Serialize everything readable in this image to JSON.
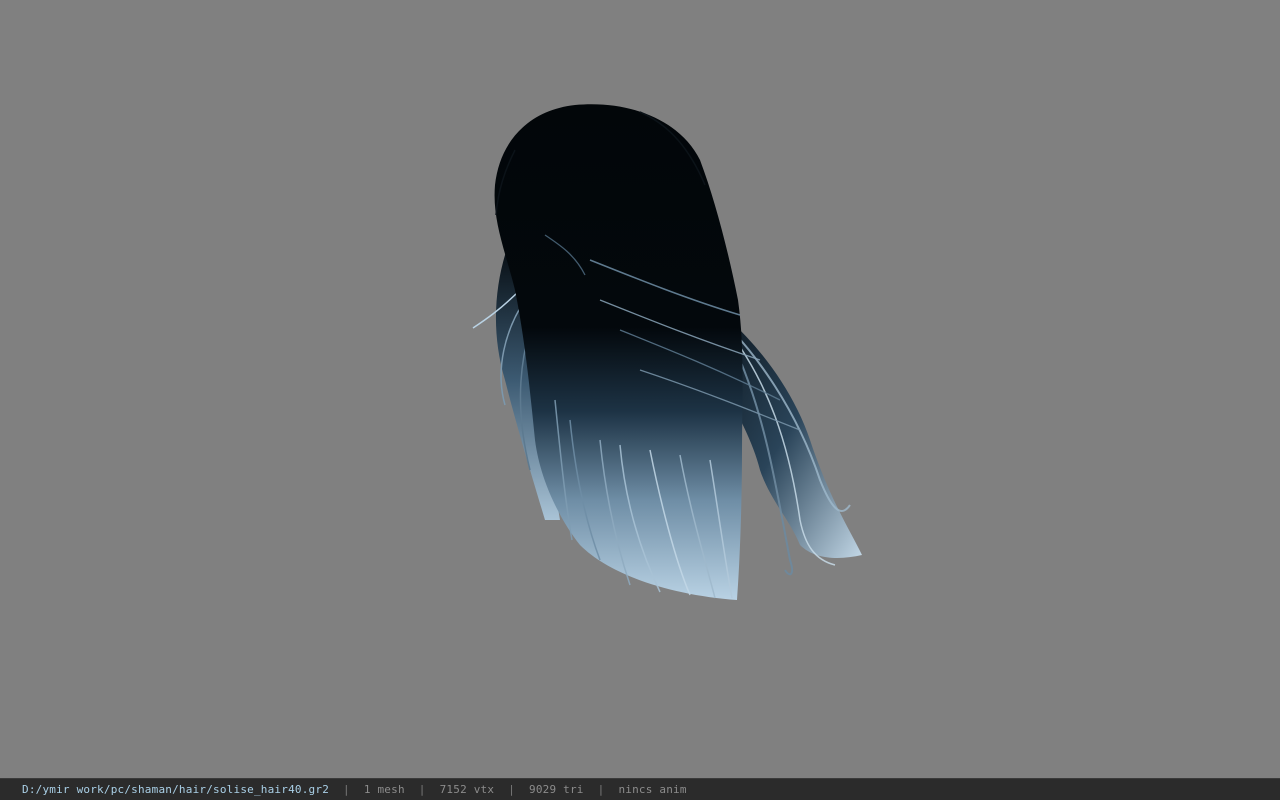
{
  "viewport": {
    "background_color": "#808080",
    "model": {
      "icon": "hair-mesh-render",
      "dark_color": "#020609",
      "mid_color": "#2f4a60",
      "light_color": "#b9d2e4"
    }
  },
  "status_bar": {
    "file_path": "D:/ymir work/pc/shaman/hair/solise_hair40.gr2",
    "separator": "|",
    "mesh_count": "1 mesh",
    "vertex_count": "7152 vtx",
    "triangle_count": "9029 tri",
    "anim_status": "nincs anim"
  }
}
